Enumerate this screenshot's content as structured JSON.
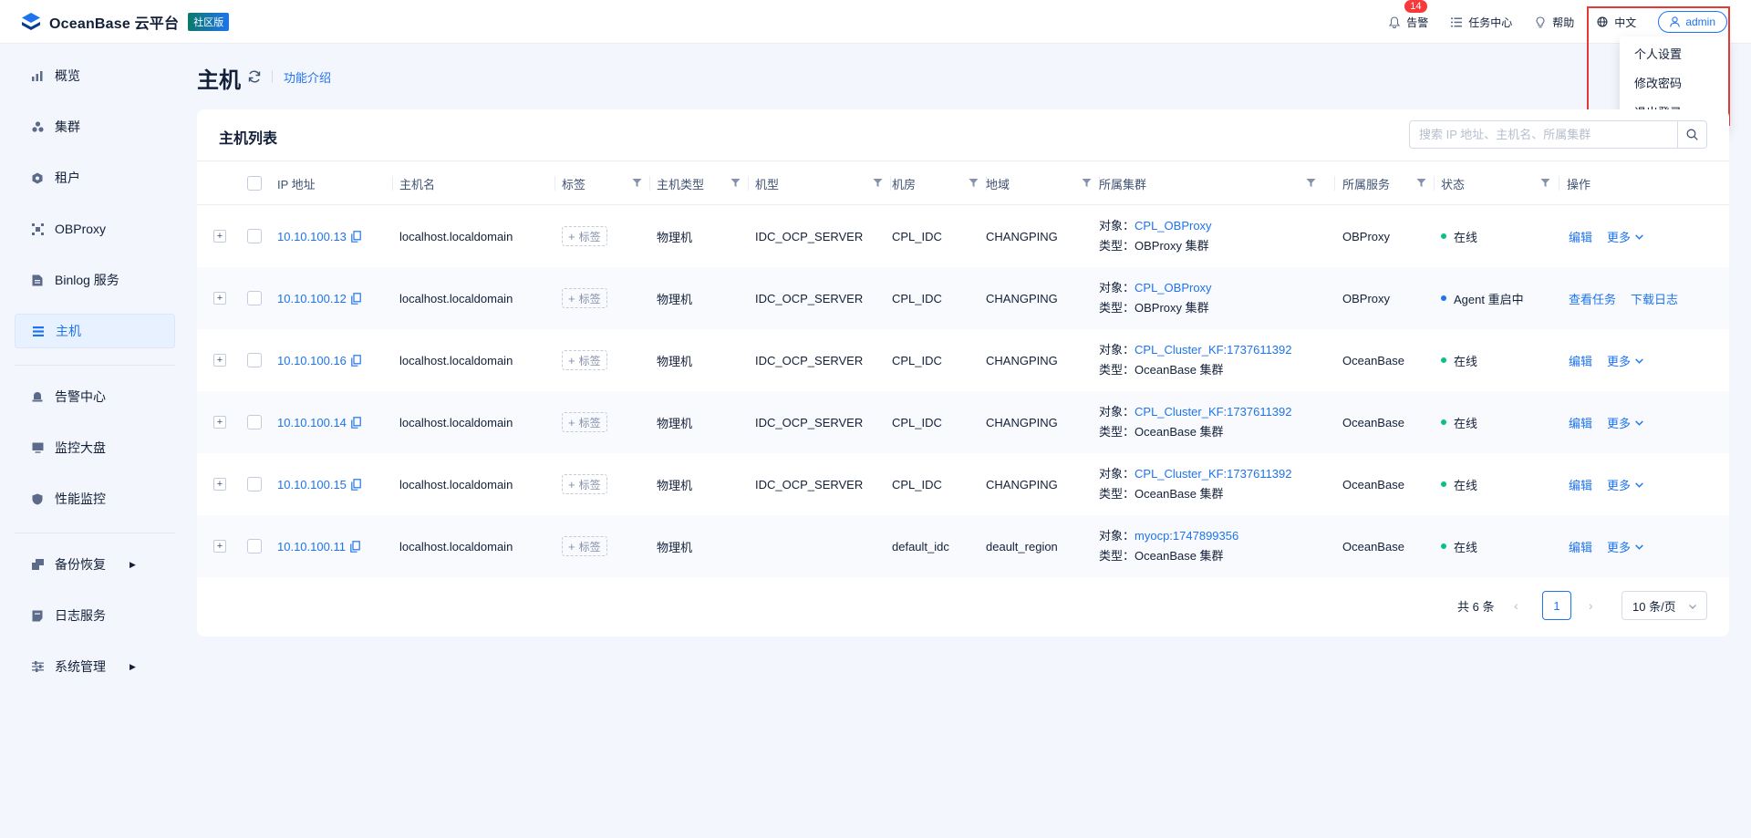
{
  "app": {
    "brand": "OceanBase 云平台",
    "edition": "社区版"
  },
  "topbar": {
    "alerts_label": "告警",
    "alerts_count": "14",
    "tasks_label": "任务中心",
    "help_label": "帮助",
    "lang_label": "中文",
    "user_label": "admin"
  },
  "user_menu": {
    "items": [
      "个人设置",
      "修改密码",
      "退出登录"
    ]
  },
  "sidebar": {
    "items": [
      {
        "label": "概览",
        "icon": "bar-chart-icon"
      },
      {
        "label": "集群",
        "icon": "cluster-icon"
      },
      {
        "label": "租户",
        "icon": "tenant-icon"
      },
      {
        "label": "OBProxy",
        "icon": "proxy-icon"
      },
      {
        "label": "Binlog 服务",
        "icon": "binlog-icon"
      },
      {
        "label": "主机",
        "icon": "host-list-icon",
        "active": true
      },
      {
        "label": "告警中心",
        "icon": "alarm-icon"
      },
      {
        "label": "监控大盘",
        "icon": "monitor-icon"
      },
      {
        "label": "性能监控",
        "icon": "shield-icon"
      },
      {
        "label": "备份恢复",
        "icon": "backup-icon",
        "expandable": true
      },
      {
        "label": "日志服务",
        "icon": "log-icon"
      },
      {
        "label": "系统管理",
        "icon": "settings-icon",
        "expandable": true
      }
    ]
  },
  "page": {
    "title": "主机",
    "feature_link": "功能介绍"
  },
  "host_list": {
    "title": "主机列表",
    "search_placeholder": "搜索 IP 地址、主机名、所属集群",
    "columns": {
      "ip": "IP 地址",
      "hostname": "主机名",
      "tags": "标签",
      "host_type": "主机类型",
      "model": "机型",
      "idc": "机房",
      "region": "地域",
      "cluster": "所属集群",
      "service": "所属服务",
      "status": "状态",
      "actions": "操作"
    },
    "object_prefix": "对象：",
    "type_prefix": "类型：",
    "tag_button": "标签",
    "rows": [
      {
        "ip": "10.10.100.13",
        "hostname": "localhost.localdomain",
        "host_type": "物理机",
        "model": "IDC_OCP_SERVER",
        "idc": "CPL_IDC",
        "region": "CHANGPING",
        "cluster_obj": "CPL_OBProxy",
        "cluster_type": "OBProxy 集群",
        "service": "OBProxy",
        "status": "在线",
        "status_color": "#0ac185",
        "action1": "编辑",
        "action2": "更多"
      },
      {
        "ip": "10.10.100.12",
        "hostname": "localhost.localdomain",
        "host_type": "物理机",
        "model": "IDC_OCP_SERVER",
        "idc": "CPL_IDC",
        "region": "CHANGPING",
        "cluster_obj": "CPL_OBProxy",
        "cluster_type": "OBProxy 集群",
        "service": "OBProxy",
        "status": "Agent 重启中",
        "status_color": "#1e74ee",
        "action1": "查看任务",
        "action2": "下载日志"
      },
      {
        "ip": "10.10.100.16",
        "hostname": "localhost.localdomain",
        "host_type": "物理机",
        "model": "IDC_OCP_SERVER",
        "idc": "CPL_IDC",
        "region": "CHANGPING",
        "cluster_obj": "CPL_Cluster_KF:1737611392",
        "cluster_type": "OceanBase 集群",
        "service": "OceanBase",
        "status": "在线",
        "status_color": "#0ac185",
        "action1": "编辑",
        "action2": "更多"
      },
      {
        "ip": "10.10.100.14",
        "hostname": "localhost.localdomain",
        "host_type": "物理机",
        "model": "IDC_OCP_SERVER",
        "idc": "CPL_IDC",
        "region": "CHANGPING",
        "cluster_obj": "CPL_Cluster_KF:1737611392",
        "cluster_type": "OceanBase 集群",
        "service": "OceanBase",
        "status": "在线",
        "status_color": "#0ac185",
        "action1": "编辑",
        "action2": "更多"
      },
      {
        "ip": "10.10.100.15",
        "hostname": "localhost.localdomain",
        "host_type": "物理机",
        "model": "IDC_OCP_SERVER",
        "idc": "CPL_IDC",
        "region": "CHANGPING",
        "cluster_obj": "CPL_Cluster_KF:1737611392",
        "cluster_type": "OceanBase 集群",
        "service": "OceanBase",
        "status": "在线",
        "status_color": "#0ac185",
        "action1": "编辑",
        "action2": "更多"
      },
      {
        "ip": "10.10.100.11",
        "hostname": "localhost.localdomain",
        "host_type": "物理机",
        "model": "",
        "idc": "default_idc",
        "region": "deault_region",
        "cluster_obj": "myocp:1747899356",
        "cluster_type": "OceanBase 集群",
        "service": "OceanBase",
        "status": "在线",
        "status_color": "#0ac185",
        "action1": "编辑",
        "action2": "更多"
      }
    ]
  },
  "pagination": {
    "total": "共 6 条",
    "current": "1",
    "page_size": "10 条/页"
  },
  "colors": {
    "accent": "#1e74ee",
    "online": "#0ac185",
    "alert": "#f93939",
    "highlight_frame": "#e53935"
  }
}
